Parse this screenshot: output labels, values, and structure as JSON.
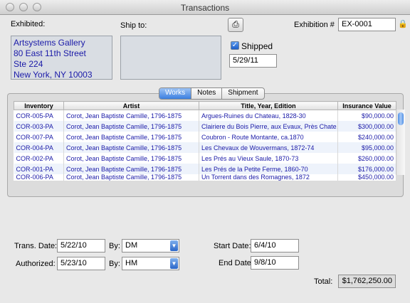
{
  "window": {
    "title": "Transactions"
  },
  "header": {
    "exhibited_label": "Exhibited:",
    "ship_to_label": "Ship to:",
    "exhibition_label": "Exhibition #",
    "exhibition_value": "EX-0001",
    "address_lines": [
      "Artsystems Gallery",
      "80 East 11th Street",
      "Ste 224",
      "New York, NY 10003"
    ],
    "shipped_label": "Shipped",
    "shipped_checked": true,
    "shipped_date": "5/29/11"
  },
  "tabs": [
    {
      "label": "Works",
      "active": true
    },
    {
      "label": "Notes",
      "active": false
    },
    {
      "label": "Shipment",
      "active": false
    }
  ],
  "table": {
    "columns": [
      "Inventory",
      "Artist",
      "Title, Year, Edition",
      "Insurance Value"
    ],
    "rows": [
      [
        "COR-005-PA",
        "Corot, Jean Baptiste Camille, 1796-1875",
        "Argues-Ruines du Chateau, 1828-30",
        "$90,000.00"
      ],
      [
        "COR-003-PA",
        "Corot, Jean Baptiste Camille, 1796-1875",
        "Clairiere du Bois Pierre, aux Evaux, Près Chate…",
        "$300,000.00"
      ],
      [
        "COR-007-PA",
        "Corot, Jean Baptiste Camille, 1796-1875",
        "Coubron - Route Montante, ca.1870",
        "$240,000.00"
      ],
      [
        "COR-004-PA",
        "Corot, Jean Baptiste Camille, 1796-1875",
        "Les Chevaux de Wouvermans, 1872-74",
        "$95,000.00"
      ],
      [
        "COR-002-PA",
        "Corot, Jean Baptiste Camille, 1796-1875",
        "Les Prés au Vieux Saule, 1870-73",
        "$260,000.00"
      ],
      [
        "COR-001-PA",
        "Corot, Jean Baptiste Camille, 1796-1875",
        "Les Prés de la Petite Ferme, 1860-70",
        "$176,000.00"
      ],
      [
        "COR-006-PA",
        "Corot, Jean Baptiste Camille, 1796-1875",
        "Un Torrent dans des Romagnes, 1872",
        "$450,000.00"
      ]
    ]
  },
  "footer": {
    "trans_date_label": "Trans. Date:",
    "trans_date": "5/22/10",
    "by_label": "By:",
    "trans_by": "DM",
    "authorized_label": "Authorized:",
    "authorized_date": "5/23/10",
    "authorized_by": "HM",
    "start_date_label": "Start Date:",
    "start_date": "6/4/10",
    "end_date_label": "End Date:",
    "end_date": "9/8/10",
    "total_label": "Total:",
    "total_value": "$1,762,250.00"
  }
}
